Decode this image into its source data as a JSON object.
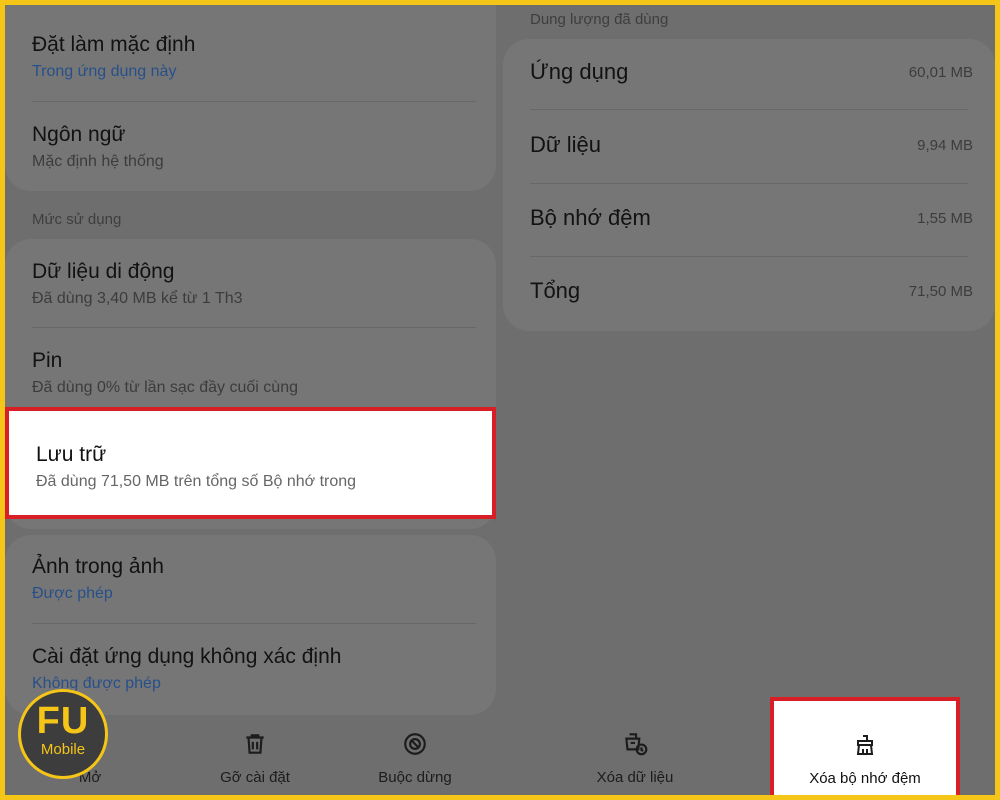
{
  "left": {
    "default_title": "Đặt làm mặc định",
    "default_sub": "Trong ứng dụng này",
    "language_title": "Ngôn ngữ",
    "language_sub": "Mặc định hệ thống",
    "usage_section": "Mức sử dụng",
    "mobile_data_title": "Dữ liệu di động",
    "mobile_data_sub": "Đã dùng 3,40 MB kể từ 1 Th3",
    "battery_title": "Pin",
    "battery_sub": "Đã dùng 0% từ lần sạc đầy cuối cùng",
    "storage_title": "Lưu trữ",
    "storage_sub": "Đã dùng 71,50 MB trên tổng số Bộ nhớ trong",
    "pip_title": "Ảnh trong ảnh",
    "pip_sub": "Được phép",
    "unknown_title": "Cài đặt ứng dụng không xác định",
    "unknown_sub": "Không được phép"
  },
  "bottom_left": {
    "open": "Mở",
    "uninstall": "Gỡ cài đặt",
    "force_stop": "Buộc dừng"
  },
  "right": {
    "section": "Dung lượng đã dùng",
    "rows": [
      {
        "name": "Ứng dụng",
        "size": "60,01 MB"
      },
      {
        "name": "Dữ liệu",
        "size": "9,94 MB"
      },
      {
        "name": "Bộ nhớ đệm",
        "size": "1,55 MB"
      },
      {
        "name": "Tổng",
        "size": "71,50 MB"
      }
    ]
  },
  "bottom_right": {
    "clear_data": "Xóa dữ liệu",
    "clear_cache": "Xóa bộ nhớ đệm"
  },
  "logo": {
    "big": "FU",
    "small": "Mobile"
  },
  "colors": {
    "frame": "#f5c518",
    "highlight_border": "#d91f26",
    "link_blue": "#27508a"
  }
}
